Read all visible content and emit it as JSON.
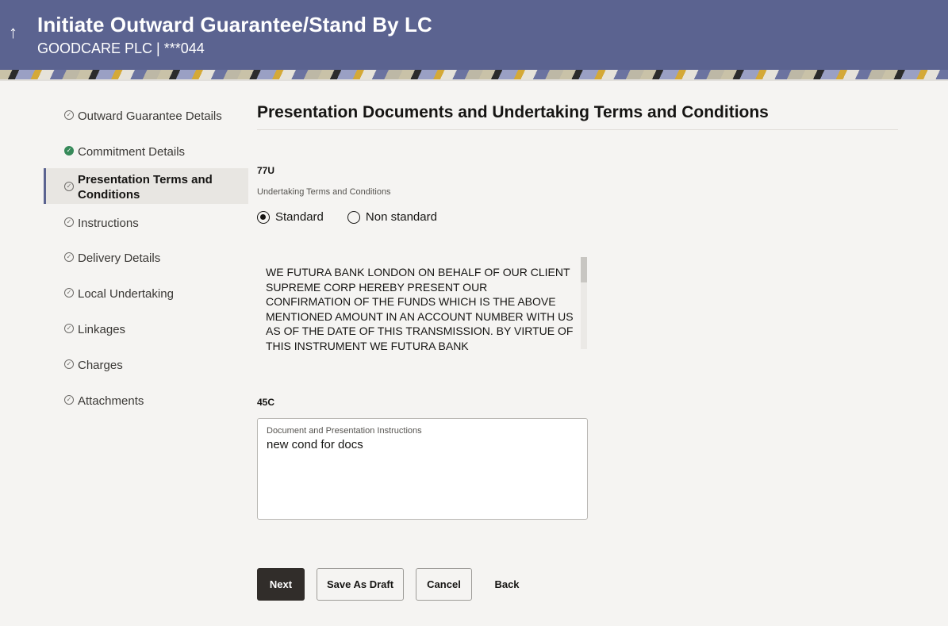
{
  "header": {
    "title": "Initiate Outward Guarantee/Stand By LC",
    "subtitle": "GOODCARE PLC | ***044",
    "back_icon": "up-arrow-icon"
  },
  "sidebar": {
    "items": [
      {
        "label": "Outward Guarantee Details",
        "status": "pending"
      },
      {
        "label": "Commitment Details",
        "status": "done"
      },
      {
        "label": "Presentation Terms and Conditions",
        "status": "active"
      },
      {
        "label": "Instructions",
        "status": "pending"
      },
      {
        "label": "Delivery Details",
        "status": "pending"
      },
      {
        "label": "Local Undertaking",
        "status": "pending"
      },
      {
        "label": "Linkages",
        "status": "pending"
      },
      {
        "label": "Charges",
        "status": "pending"
      },
      {
        "label": "Attachments",
        "status": "pending"
      }
    ]
  },
  "main": {
    "section_title": "Presentation Documents and Undertaking Terms and Conditions",
    "field_77u": {
      "tag": "77U",
      "label": "Undertaking Terms and Conditions",
      "options": [
        "Standard",
        "Non standard"
      ],
      "selected": "Standard",
      "terms_text": "WE FUTURA BANK LONDON ON BEHALF OF OUR CLIENT SUPREME CORP HEREBY PRESENT OUR CONFIRMATION OF THE FUNDS WHICH IS THE ABOVE MENTIONED AMOUNT IN AN ACCOUNT NUMBER WITH US AS OF THE DATE OF THIS TRANSMISSION. BY VIRTUE OF THIS INSTRUMENT WE FUTURA BANK"
    },
    "field_45c": {
      "tag": "45C",
      "label": "Document and Presentation Instructions",
      "value": "new cond for docs"
    }
  },
  "actions": {
    "next": "Next",
    "save_draft": "Save As Draft",
    "cancel": "Cancel",
    "back": "Back"
  },
  "colors": {
    "header_bg": "#5b6390",
    "done_green": "#378a5a",
    "primary_button": "#312d2a"
  }
}
